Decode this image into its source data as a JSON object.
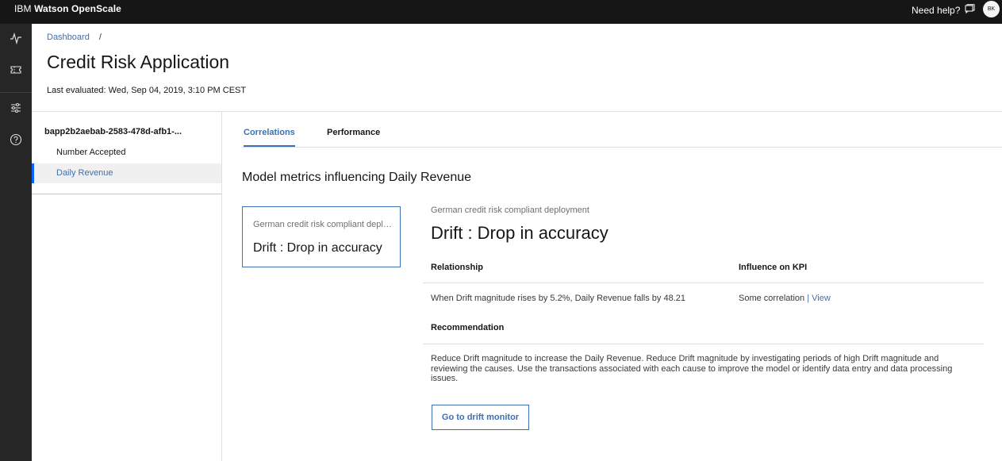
{
  "topbar": {
    "brand_prefix": "IBM",
    "brand_name": "Watson OpenScale",
    "help_label": "Need help?",
    "avatar_initials": "BK"
  },
  "siderail": {
    "items": [
      {
        "icon": "activity-icon"
      },
      {
        "icon": "ticket-icon"
      },
      {
        "icon": "sliders-icon"
      },
      {
        "icon": "help-icon"
      }
    ]
  },
  "header": {
    "breadcrumb": {
      "link": "Dashboard",
      "separator": "/"
    },
    "title": "Credit Risk Application",
    "last_evaluated": "Last evaluated: Wed, Sep 04, 2019, 3:10 PM CEST"
  },
  "leftnav": {
    "deployment": "bapp2b2aebab-2583-478d-afb1-...",
    "items": [
      {
        "label": "Number Accepted",
        "active": false
      },
      {
        "label": "Daily Revenue",
        "active": true
      }
    ]
  },
  "tabs": [
    {
      "label": "Correlations",
      "active": true
    },
    {
      "label": "Performance",
      "active": false
    }
  ],
  "main": {
    "section_title": "Model metrics influencing Daily Revenue",
    "card": {
      "subtitle": "German credit risk compliant deployment",
      "title": "Drift : Drop in accuracy"
    },
    "detail": {
      "subtitle": "German credit risk compliant deployment",
      "title": "Drift : Drop in accuracy",
      "relationship_header": "Relationship",
      "influence_header": "Influence on KPI",
      "relationship_value": "When Drift magnitude rises by 5.2%, Daily Revenue falls by 48.21",
      "influence_value": "Some correlation",
      "influence_separator": "|",
      "influence_link": "View",
      "recommendation_header": "Recommendation",
      "recommendation_text": "Reduce Drift magnitude to increase the Daily Revenue. Reduce Drift magnitude by investigating periods of high Drift magnitude and reviewing the causes. Use the transactions associated with each cause to improve the model or identify data entry and data processing issues.",
      "button_label": "Go to drift monitor"
    }
  },
  "colors": {
    "topbar_bg": "#161616",
    "siderail_bg": "#262626",
    "accent": "#3d70b2",
    "active_nav_bg": "#f0f0f0"
  }
}
